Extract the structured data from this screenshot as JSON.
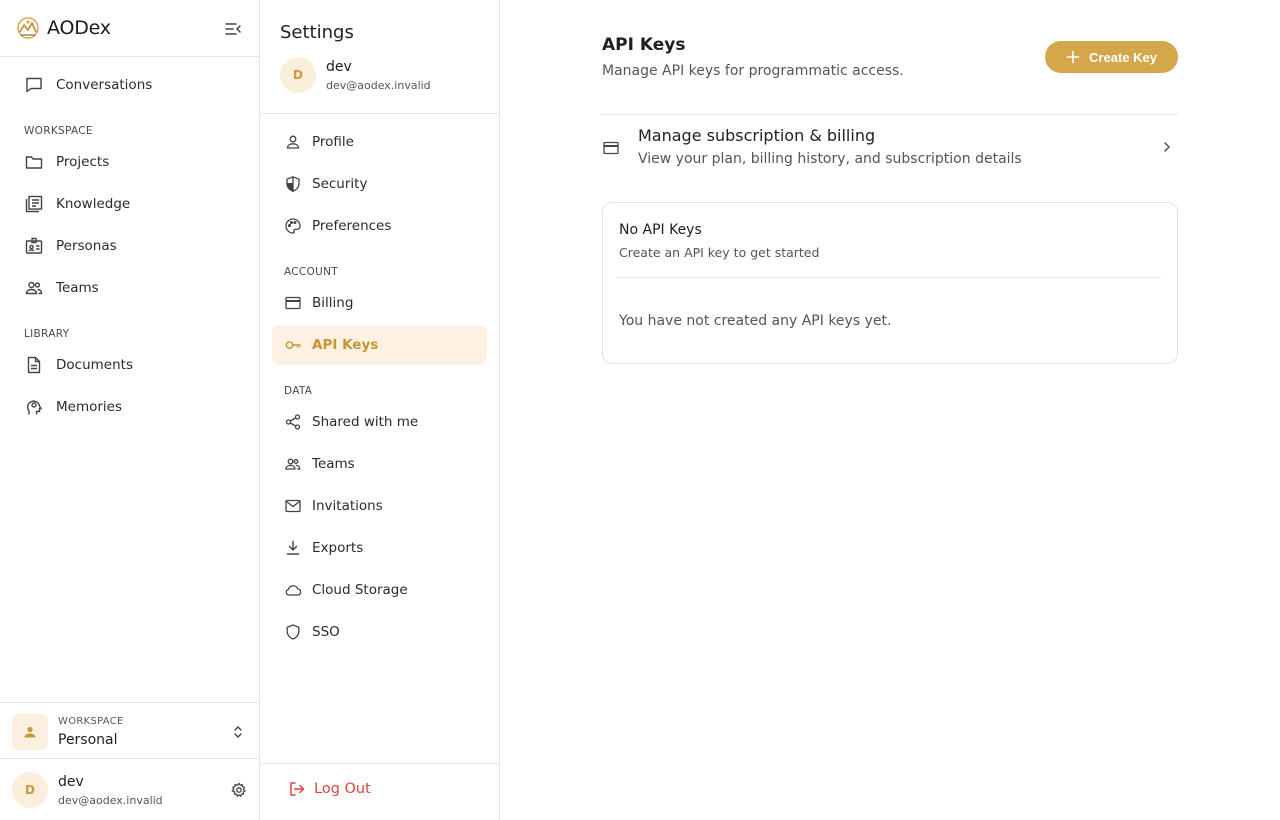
{
  "brand": {
    "name": "AODex"
  },
  "sidebar": {
    "top_item": "Conversations",
    "workspace_label": "WORKSPACE",
    "workspace_items": [
      "Projects",
      "Knowledge",
      "Personas",
      "Teams"
    ],
    "library_label": "LIBRARY",
    "library_items": [
      "Documents",
      "Memories"
    ],
    "workspace_switcher": {
      "label": "WORKSPACE",
      "value": "Personal"
    },
    "user": {
      "initial": "D",
      "name": "dev",
      "email": "dev@aodex.invalid"
    }
  },
  "settings": {
    "title": "Settings",
    "user": {
      "initial": "D",
      "name": "dev",
      "email": "dev@aodex.invalid"
    },
    "items": [
      "Profile",
      "Security",
      "Preferences"
    ],
    "account_label": "ACCOUNT",
    "account_items": [
      "Billing",
      "API Keys"
    ],
    "data_label": "DATA",
    "data_items": [
      "Shared with me",
      "Teams",
      "Invitations",
      "Exports",
      "Cloud Storage",
      "SSO"
    ],
    "active_item": "API Keys",
    "logout": "Log Out"
  },
  "main": {
    "title": "API Keys",
    "subtitle": "Manage API keys for programmatic access.",
    "create_button": "Create Key",
    "billing": {
      "title": "Manage subscription & billing",
      "subtitle": "View your plan, billing history, and subscription details"
    },
    "empty": {
      "title": "No API Keys",
      "subtitle": "Create an API key to get started",
      "message": "You have not created any API keys yet."
    }
  },
  "colors": {
    "accent": "#d4a74a",
    "active_bg": "#fcf1e2",
    "danger": "#e0443e"
  }
}
